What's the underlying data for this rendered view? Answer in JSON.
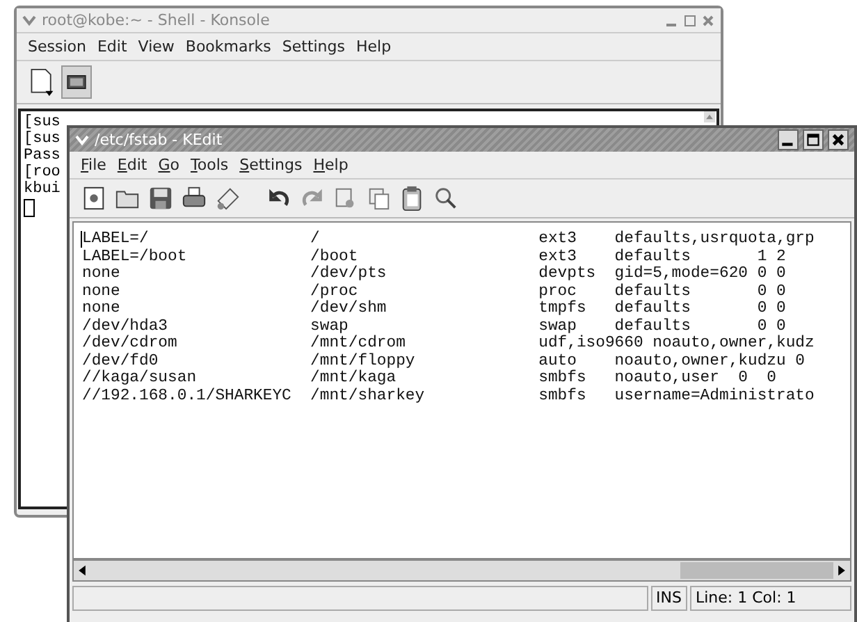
{
  "konsole": {
    "title": "root@kobe:~ - Shell - Konsole",
    "menu": [
      "Session",
      "Edit",
      "View",
      "Bookmarks",
      "Settings",
      "Help"
    ],
    "terminal_lines": [
      "[sus",
      "[sus",
      "Pass",
      "[roo",
      "kbui"
    ]
  },
  "kedit": {
    "title": "/etc/fstab - KEdit",
    "menu": [
      "File",
      "Edit",
      "Go",
      "Tools",
      "Settings",
      "Help"
    ],
    "lines": [
      "LABEL=/                 /                       ext3    defaults,usrquota,grp",
      "LABEL=/boot             /boot                   ext3    defaults       1 2",
      "none                    /dev/pts                devpts  gid=5,mode=620 0 0",
      "none                    /proc                   proc    defaults       0 0",
      "none                    /dev/shm                tmpfs   defaults       0 0",
      "/dev/hda3               swap                    swap    defaults       0 0",
      "/dev/cdrom              /mnt/cdrom              udf,iso9660 noauto,owner,kudz",
      "/dev/fd0                /mnt/floppy             auto    noauto,owner,kudzu 0",
      "//kaga/susan            /mnt/kaga               smbfs   noauto,user  0  0",
      "//192.168.0.1/SHARKEYC  /mnt/sharkey            smbfs   username=Administrato"
    ],
    "status": {
      "mode": "INS",
      "position": "Line: 1 Col: 1"
    }
  }
}
